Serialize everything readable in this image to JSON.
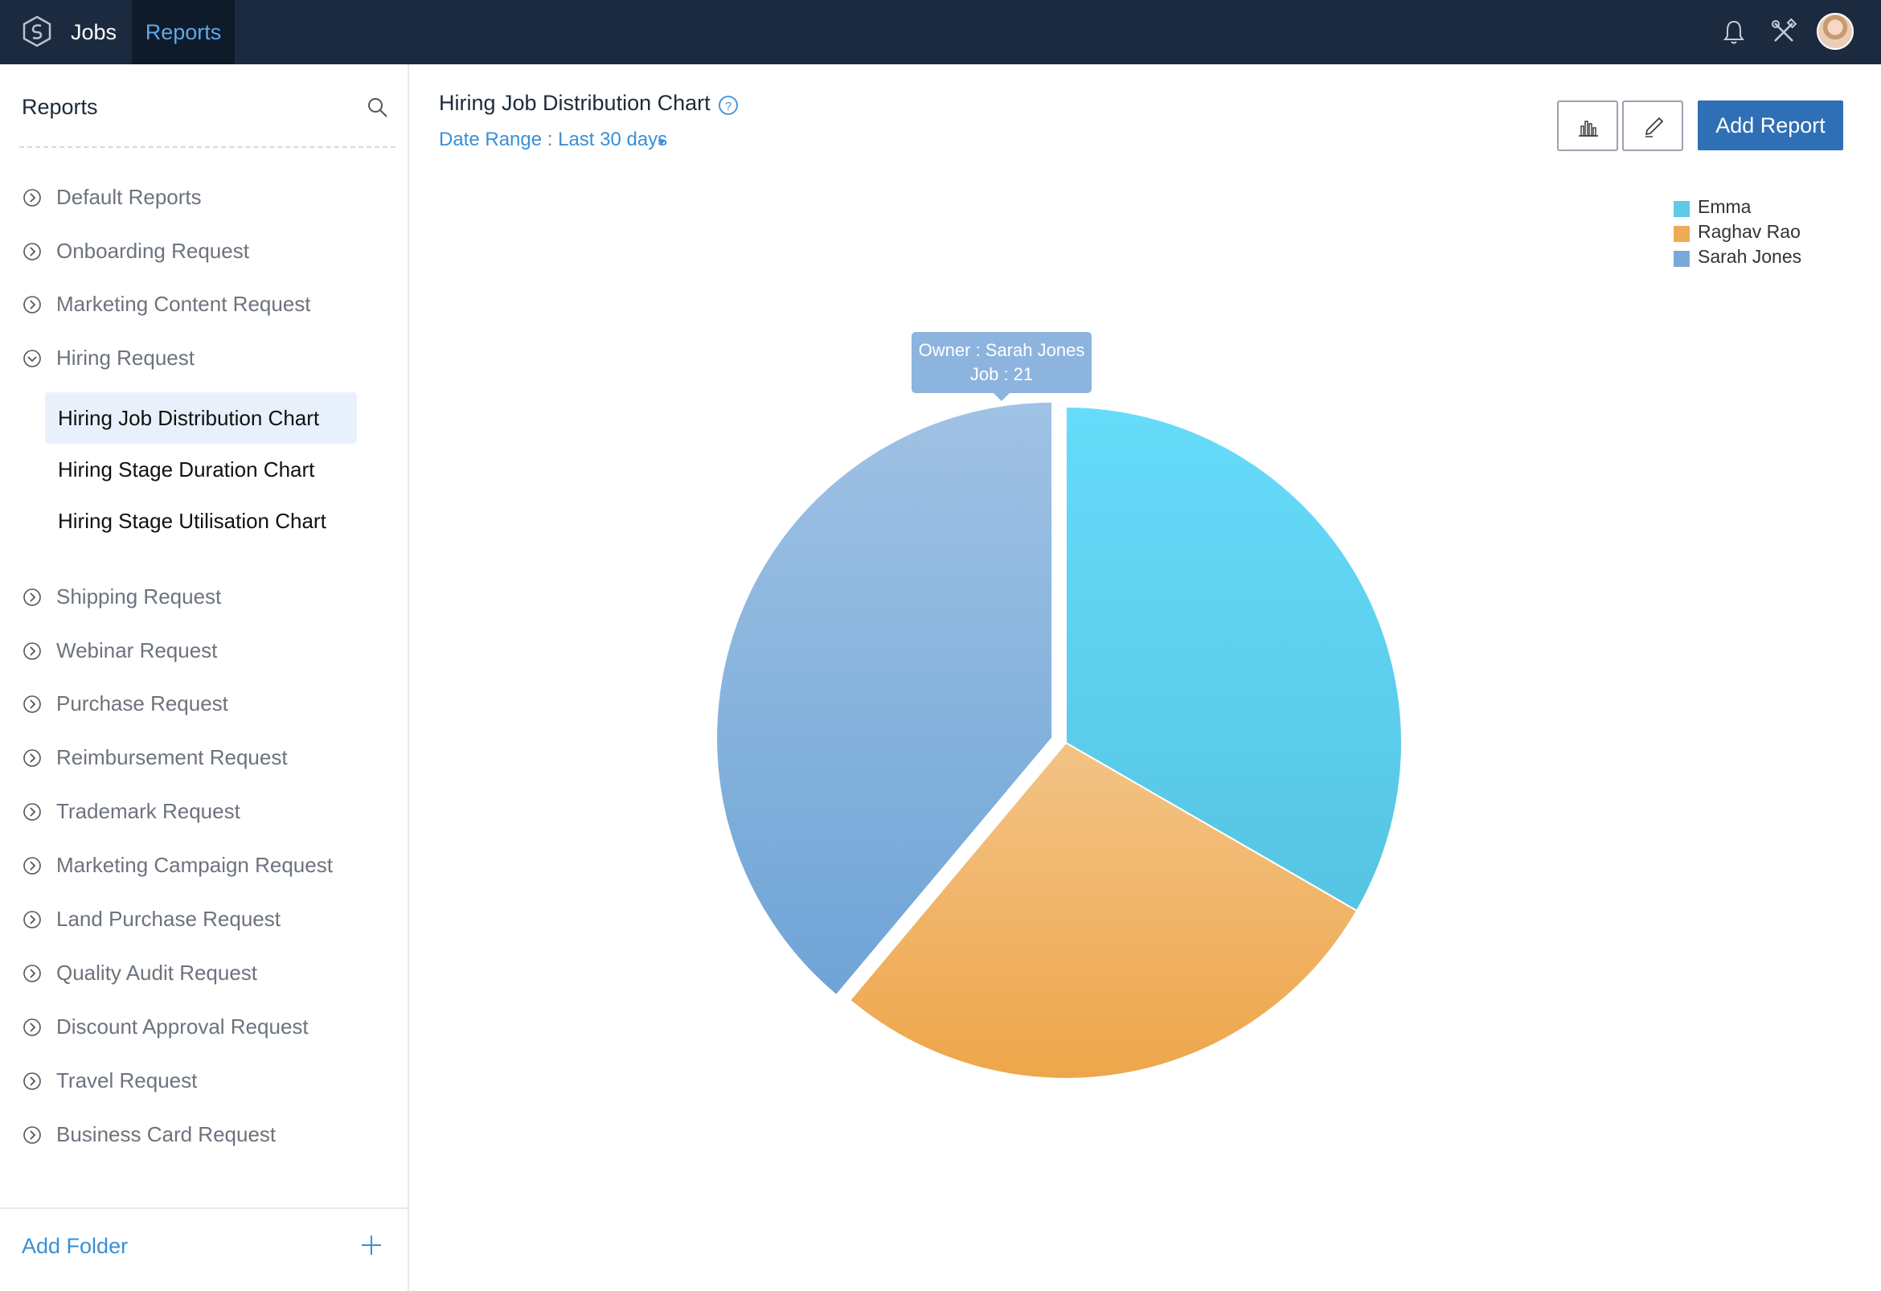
{
  "topbar": {
    "nav": [
      {
        "label": "Jobs",
        "icon": "jobs-hexagon-logo-icon"
      },
      {
        "label": "Reports"
      }
    ],
    "icons": [
      "bell-icon",
      "tools-icon",
      "user-avatar"
    ]
  },
  "sidebar": {
    "title": "Reports",
    "folders_top": [
      {
        "label": "Default Reports",
        "icon": "chevron-right-circle-icon"
      },
      {
        "label": "Onboarding Request",
        "icon": "chevron-right-circle-icon"
      },
      {
        "label": "Marketing Content Request",
        "icon": "chevron-right-circle-icon"
      },
      {
        "label": "Hiring Request",
        "icon": "chevron-down-circle-icon"
      }
    ],
    "hiring_items": [
      {
        "label": "Hiring Job Distribution Chart",
        "active": true
      },
      {
        "label": "Hiring Stage Duration Chart"
      },
      {
        "label": "Hiring Stage Utilisation Chart"
      }
    ],
    "folders_bottom": [
      {
        "label": "Shipping Request"
      },
      {
        "label": "Webinar Request"
      },
      {
        "label": "Purchase Request"
      },
      {
        "label": "Reimbursement Request"
      },
      {
        "label": "Trademark Request"
      },
      {
        "label": "Marketing Campaign Request"
      },
      {
        "label": "Land Purchase Request"
      },
      {
        "label": "Quality Audit Request"
      },
      {
        "label": "Discount Approval Request"
      },
      {
        "label": "Travel Request"
      },
      {
        "label": "Business Card Request"
      }
    ],
    "add_folder": "Add Folder"
  },
  "main": {
    "title": "Hiring Job Distribution Chart",
    "date_range": "Date Range : Last 30 days",
    "add_report": "Add Report"
  },
  "colors": {
    "topbar": "#1c2a3f",
    "accent": "#3a8fd8",
    "button": "#2f6fb5",
    "emma": "#5ccbe8",
    "raghav": "#efaa55",
    "sarah": "#7aa9d8"
  },
  "tooltip": {
    "line1": "Owner : Sarah Jones",
    "line2": "Job : 21"
  },
  "chart_data": {
    "type": "pie",
    "title": "",
    "series": [
      {
        "name": "Emma",
        "value": 18
      },
      {
        "name": "Raghav Rao",
        "value": 15
      },
      {
        "name": "Sarah Jones",
        "value": 21
      }
    ],
    "legend_position": "top-right"
  }
}
